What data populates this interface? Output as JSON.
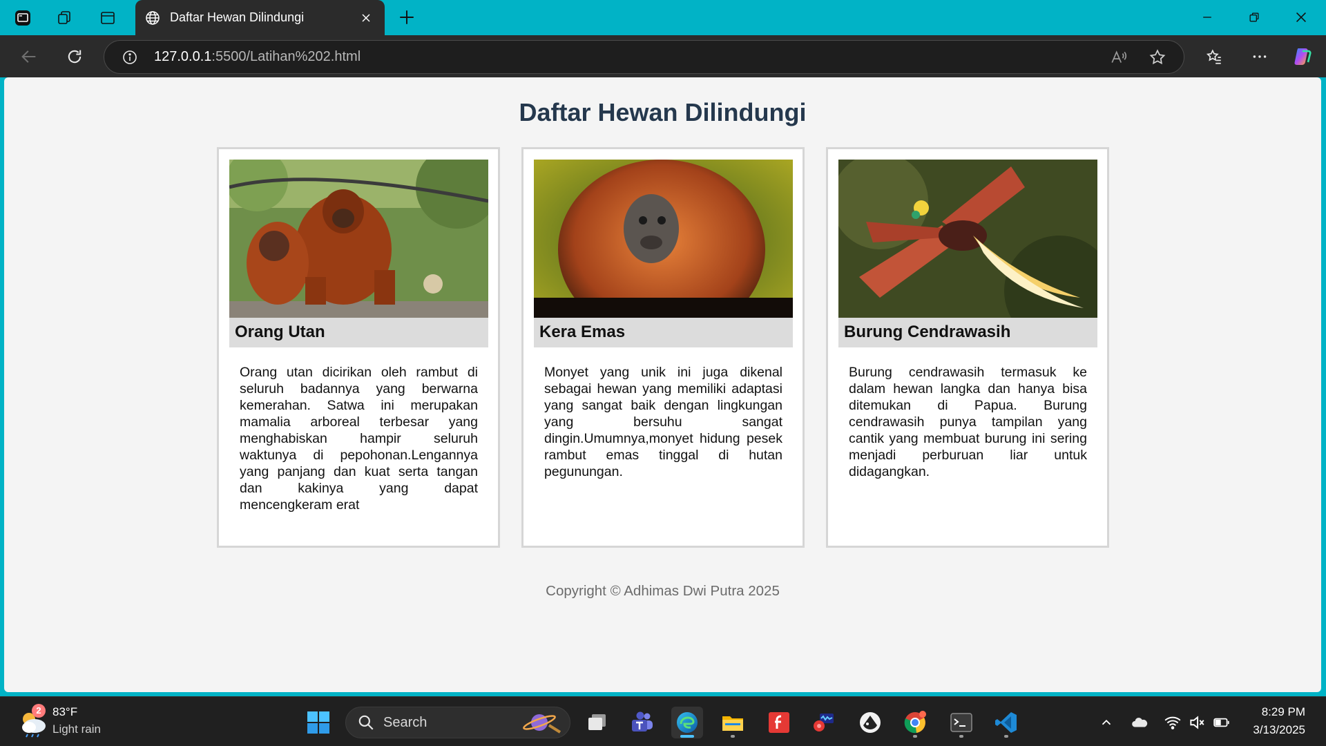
{
  "browser": {
    "tab_title": "Daftar Hewan Dilindungi",
    "url_host": "127.0.0.1",
    "url_path": ":5500/Latihan%202.html"
  },
  "page": {
    "title": "Daftar Hewan Dilindungi",
    "cards": [
      {
        "name": "Orang Utan",
        "image": "orangutan-photo",
        "description": "Orang utan dicirikan oleh rambut di seluruh badannya yang berwarna kemerahan. Satwa ini merupakan mamalia arboreal terbesar yang menghabiskan hampir seluruh waktunya di pepohonan.Lengannya yang panjang dan kuat serta tangan dan kakinya yang dapat mencengkeram erat"
      },
      {
        "name": "Kera Emas",
        "image": "golden-lion-tamarin-photo",
        "description": "Monyet yang unik ini juga dikenal sebagai hewan yang memiliki adaptasi yang sangat baik dengan lingkungan yang bersuhu sangat dingin.Umumnya,monyet hidung pesek rambut emas tinggal di hutan pegunungan."
      },
      {
        "name": "Burung Cendrawasih",
        "image": "bird-of-paradise-photo",
        "description": "Burung cendrawasih termasuk ke dalam hewan langka dan hanya bisa ditemukan di Papua. Burung cendrawasih punya tampilan yang cantik yang membuat burung ini sering menjadi perburuan liar untuk didagangkan."
      }
    ],
    "footer": "Copyright © Adhimas Dwi Putra 2025"
  },
  "taskbar": {
    "weather_badge": "2",
    "weather_temp": "83°F",
    "weather_condition": "Light rain",
    "search_label": "Search",
    "time": "8:29 PM",
    "date": "3/13/2025"
  },
  "colors": {
    "titlebar": "#01b3c6",
    "page_title": "#25384d",
    "card_name_bg": "#dcdcdc",
    "taskbar": "#202020"
  }
}
